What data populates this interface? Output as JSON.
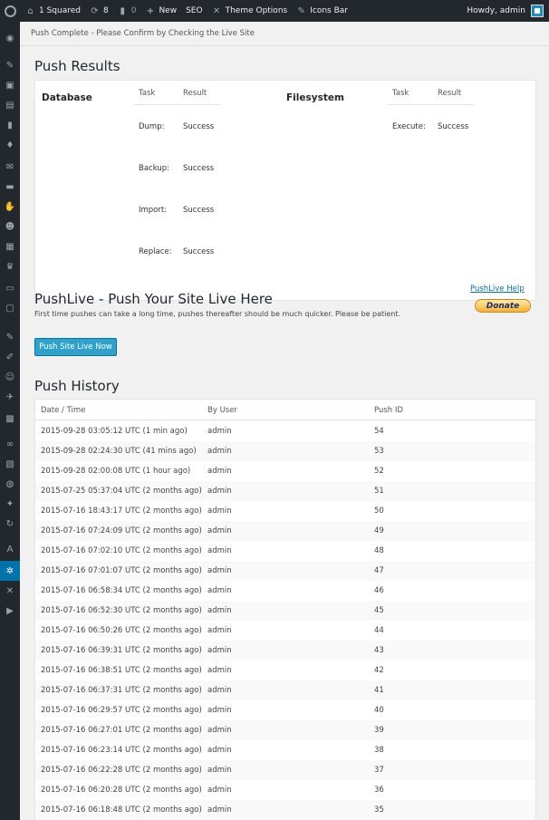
{
  "admin_bar": {
    "site_name": "1 Squared",
    "updates_count": "8",
    "comments_count": "0",
    "new_label": "New",
    "seo_label": "SEO",
    "theme_options_label": "Theme Options",
    "icons_bar_label": "Icons Bar",
    "howdy_label": "Howdy, admin"
  },
  "notice": "Push Complete - Please Confirm by Checking the Live Site",
  "push_results": {
    "title": "Push Results",
    "database": {
      "label": "Database",
      "col_task": "Task",
      "col_result": "Result",
      "rows": [
        {
          "task": "Dump:",
          "result": "Success"
        },
        {
          "task": "Backup:",
          "result": "Success"
        },
        {
          "task": "Import:",
          "result": "Success"
        },
        {
          "task": "Replace:",
          "result": "Success"
        }
      ]
    },
    "filesystem": {
      "label": "Filesystem",
      "col_task": "Task",
      "col_result": "Result",
      "rows": [
        {
          "task": "Execute:",
          "result": "Success"
        }
      ]
    }
  },
  "pushlive": {
    "title": "PushLive - Push Your Site Live Here",
    "description": "First time pushes can take a long time, pushes thereafter should be much quicker. Please be patient.",
    "help_link": "PushLive Help",
    "donate_label": "Donate",
    "push_button": "Push Site Live Now"
  },
  "history": {
    "title": "Push History",
    "columns": [
      "Date / Time",
      "By User",
      "Push ID"
    ],
    "rows": [
      {
        "date": "2015-09-28 03:05:12 UTC (1 min ago)",
        "user": "admin",
        "id": "54"
      },
      {
        "date": "2015-09-28 02:24:30 UTC (41 mins ago)",
        "user": "admin",
        "id": "53"
      },
      {
        "date": "2015-09-28 02:00:08 UTC (1 hour ago)",
        "user": "admin",
        "id": "52"
      },
      {
        "date": "2015-07-25 05:37:04 UTC (2 months ago)",
        "user": "admin",
        "id": "51"
      },
      {
        "date": "2015-07-16 18:43:17 UTC (2 months ago)",
        "user": "admin",
        "id": "50"
      },
      {
        "date": "2015-07-16 07:24:09 UTC (2 months ago)",
        "user": "admin",
        "id": "49"
      },
      {
        "date": "2015-07-16 07:02:10 UTC (2 months ago)",
        "user": "admin",
        "id": "48"
      },
      {
        "date": "2015-07-16 07:01:07 UTC (2 months ago)",
        "user": "admin",
        "id": "47"
      },
      {
        "date": "2015-07-16 06:58:34 UTC (2 months ago)",
        "user": "admin",
        "id": "46"
      },
      {
        "date": "2015-07-16 06:52:30 UTC (2 months ago)",
        "user": "admin",
        "id": "45"
      },
      {
        "date": "2015-07-16 06:50:26 UTC (2 months ago)",
        "user": "admin",
        "id": "44"
      },
      {
        "date": "2015-07-16 06:39:31 UTC (2 months ago)",
        "user": "admin",
        "id": "43"
      },
      {
        "date": "2015-07-16 06:38:51 UTC (2 months ago)",
        "user": "admin",
        "id": "42"
      },
      {
        "date": "2015-07-16 06:37:31 UTC (2 months ago)",
        "user": "admin",
        "id": "41"
      },
      {
        "date": "2015-07-16 06:29:57 UTC (2 months ago)",
        "user": "admin",
        "id": "40"
      },
      {
        "date": "2015-07-16 06:27:01 UTC (2 months ago)",
        "user": "admin",
        "id": "39"
      },
      {
        "date": "2015-07-16 06:23:14 UTC (2 months ago)",
        "user": "admin",
        "id": "38"
      },
      {
        "date": "2015-07-16 06:22:28 UTC (2 months ago)",
        "user": "admin",
        "id": "37"
      },
      {
        "date": "2015-07-16 06:20:28 UTC (2 months ago)",
        "user": "admin",
        "id": "36"
      },
      {
        "date": "2015-07-16 06:18:48 UTC (2 months ago)",
        "user": "admin",
        "id": "35"
      }
    ]
  },
  "colors": {
    "admin_bar": "#23282d",
    "accent": "#0073aa",
    "button": "#2ea2cc"
  },
  "side_menu_icons": [
    "dashboard-icon",
    "pin-icon",
    "media-icon",
    "pages-icon",
    "comments-icon",
    "diamond-icon",
    "mail-icon",
    "portfolio-icon",
    "thumbs-up-icon",
    "users-group-icon",
    "grid-icon",
    "trophy-icon",
    "slides-icon",
    "monitor-icon",
    "brush-icon",
    "plugin-icon",
    "user-icon",
    "wrench-icon",
    "settings-sub-icon",
    "link-icon",
    "gallery-icon",
    "globe-icon",
    "twitter-icon",
    "sync-icon",
    "font-icon",
    "gear-icon",
    "tools-icon",
    "play-icon"
  ]
}
